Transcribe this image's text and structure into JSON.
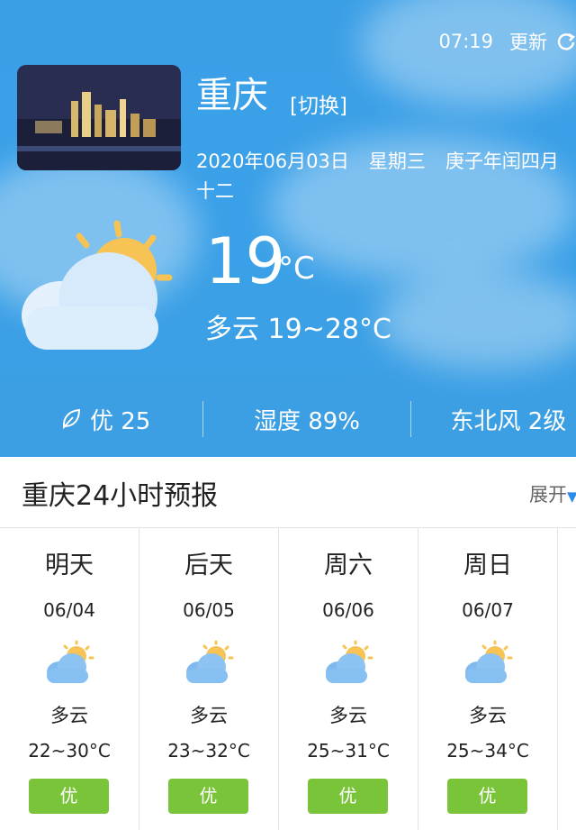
{
  "topbar": {
    "time": "07:19",
    "update_label": "更新"
  },
  "location": {
    "city": "重庆",
    "switch_label": "[切换]"
  },
  "date": {
    "gregorian": "2020年06月03日",
    "weekday": "星期三",
    "lunar": "庚子年闰四月十二"
  },
  "current": {
    "temperature": "19",
    "unit": "°C",
    "condition_range": "多云 19~28°C",
    "icon": "partly-cloudy-icon"
  },
  "stats": {
    "aqi": "优 25",
    "humidity": "湿度 89%",
    "wind": "东北风 2级"
  },
  "forecast": {
    "title": "重庆24小时预报",
    "expand_label": "展开",
    "days": [
      {
        "name": "明天",
        "date": "06/04",
        "condition": "多云",
        "range": "22~30°C",
        "aqi": "优"
      },
      {
        "name": "后天",
        "date": "06/05",
        "condition": "多云",
        "range": "23~32°C",
        "aqi": "优"
      },
      {
        "name": "周六",
        "date": "06/06",
        "condition": "多云",
        "range": "25~31°C",
        "aqi": "优"
      },
      {
        "name": "周日",
        "date": "06/07",
        "condition": "多云",
        "range": "25~34°C",
        "aqi": "优"
      }
    ]
  },
  "colors": {
    "sky": "#3aa0e8",
    "aqi_badge": "#7ac43a",
    "accent": "#2c8ae8"
  }
}
